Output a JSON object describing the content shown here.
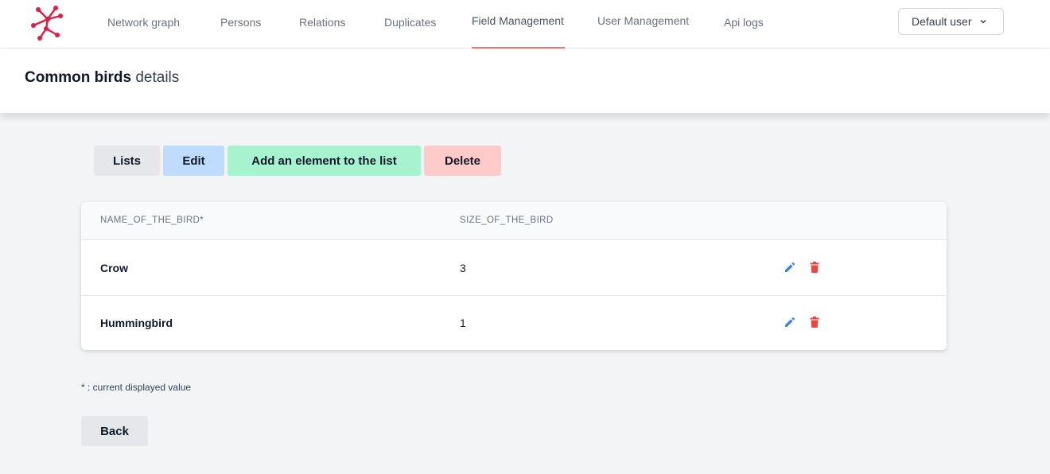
{
  "nav": {
    "logo_icon": "network-logo-icon",
    "items": [
      {
        "label": "Network graph"
      },
      {
        "label": "Persons"
      },
      {
        "label": "Relations"
      },
      {
        "label": "Duplicates"
      },
      {
        "label": "Field Management",
        "active": true
      },
      {
        "label": "User Management"
      },
      {
        "label": "Api logs"
      }
    ],
    "user_menu": {
      "label": "Default user",
      "icon": "chevron-down-icon"
    }
  },
  "header": {
    "title_strong": "Common birds",
    "title_rest": "details"
  },
  "toolbar": {
    "lists_label": "Lists",
    "edit_label": "Edit",
    "add_label": "Add an element to the list",
    "delete_label": "Delete"
  },
  "table": {
    "columns": [
      "NAME_OF_THE_BIRD*",
      "SIZE_OF_THE_BIRD"
    ],
    "rows": [
      {
        "name": "Crow",
        "size": "3"
      },
      {
        "name": "Hummingbird",
        "size": "1"
      }
    ],
    "row_actions": [
      "pencil-icon",
      "trash-icon"
    ]
  },
  "footer": {
    "note": "* : current displayed value",
    "back_label": "Back"
  },
  "colors": {
    "accent": "#f87171",
    "edit_icon": "#3b82f6",
    "delete_icon": "#ef4444",
    "btn_lists": "#e5e7eb",
    "btn_edit": "#bfdbfe",
    "btn_add": "#a7f3d0",
    "btn_delete": "#fecaca"
  }
}
